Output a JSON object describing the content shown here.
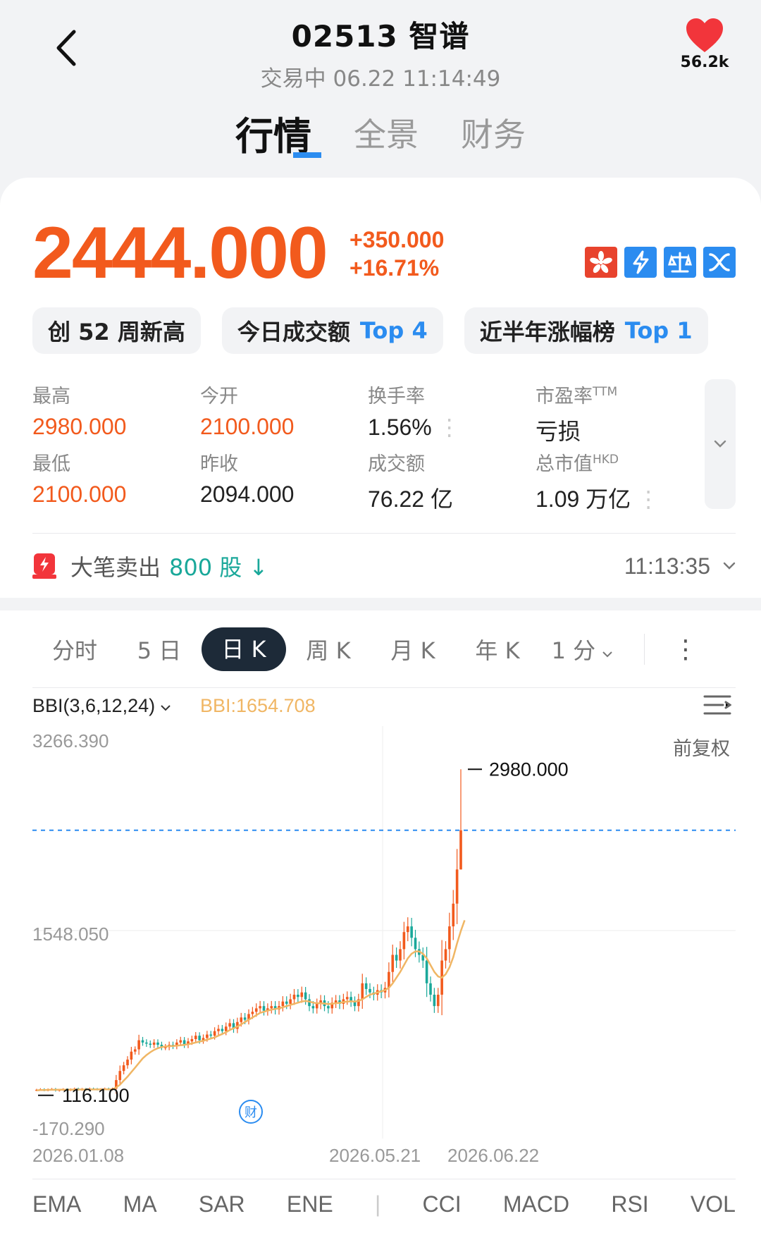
{
  "header": {
    "title": "02513 智谱",
    "status": "交易中 06.22 11:14:49",
    "favorites": "56.2k"
  },
  "tabs": [
    "行情",
    "全景",
    "财务"
  ],
  "quote": {
    "price": "2444.000",
    "change": "+350.000",
    "change_pct": "+16.71%"
  },
  "pills": [
    {
      "label": "创 52 周新高",
      "top": ""
    },
    {
      "label": "今日成交额",
      "top": "Top 4"
    },
    {
      "label": "近半年涨幅榜",
      "top": "Top 1"
    }
  ],
  "stats": {
    "high_label": "最高",
    "high": "2980.000",
    "open_label": "今开",
    "open": "2100.000",
    "turnover_label": "换手率",
    "turnover": "1.56%",
    "pe_label": "市盈率",
    "pe_sup": "TTM",
    "pe": "亏损",
    "low_label": "最低",
    "low": "2100.000",
    "prev_label": "昨收",
    "prev": "2094.000",
    "amount_label": "成交额",
    "amount": "76.22 亿",
    "mcap_label": "总市值",
    "mcap_sup": "HKD",
    "mcap": "1.09 万亿"
  },
  "trade": {
    "label": "大笔卖出",
    "qty": "800 股 ↓",
    "time": "11:13:35"
  },
  "ktabs": [
    "分时",
    "5 日",
    "日 K",
    "周 K",
    "月 K",
    "年 K",
    "1 分"
  ],
  "indicator": {
    "name": "BBI(3,6,12,24)",
    "value": "BBI:1654.708",
    "adjust": "前复权"
  },
  "chart_data": {
    "type": "candlestick",
    "y_labels": [
      "3266.390",
      "1548.050",
      "-170.290"
    ],
    "max_label": "2980.000",
    "min_label": "116.100",
    "x_labels": [
      "2026.01.08",
      "2026.05.21",
      "2026.06.22"
    ],
    "ylim": [
      -170.29,
      3266.39
    ],
    "dashed_price": 2444.0,
    "colors": {
      "up": "#f25a1d",
      "down": "#1aa89a",
      "bbi": "#f0b664",
      "dash": "#2b8cf0"
    },
    "closes": [
      165,
      170,
      160,
      168,
      172,
      158,
      165,
      170,
      162,
      168,
      175,
      165,
      172,
      168,
      175,
      172,
      168,
      170,
      175,
      168,
      175,
      250,
      330,
      380,
      430,
      500,
      520,
      600,
      580,
      570,
      560,
      580,
      560,
      540,
      540,
      560,
      550,
      580,
      600,
      560,
      590,
      610,
      640,
      600,
      620,
      650,
      640,
      680,
      700,
      680,
      720,
      750,
      700,
      760,
      800,
      780,
      830,
      850,
      880,
      900,
      860,
      880,
      900,
      870,
      900,
      940,
      920,
      960,
      1000,
      980,
      1020,
      960,
      900,
      880,
      920,
      950,
      900,
      880,
      930,
      950,
      920,
      960,
      980,
      940,
      900,
      960,
      1100,
      1050,
      1020,
      1000,
      1040,
      1020,
      1060,
      1200,
      1350,
      1300,
      1400,
      1550,
      1600,
      1500,
      1400,
      1350,
      1300,
      1100,
      1000,
      900,
      1000,
      1300,
      1400,
      1600,
      1800,
      2100,
      2444
    ],
    "bbi": [
      160,
      162,
      162,
      164,
      165,
      165,
      166,
      166,
      166,
      166,
      167,
      167,
      167,
      167,
      168,
      168,
      168,
      168,
      169,
      169,
      169,
      185,
      210,
      245,
      280,
      320,
      360,
      400,
      440,
      470,
      495,
      515,
      530,
      540,
      545,
      548,
      550,
      552,
      556,
      560,
      565,
      572,
      580,
      588,
      595,
      605,
      615,
      625,
      640,
      655,
      670,
      690,
      705,
      720,
      740,
      760,
      780,
      800,
      820,
      840,
      850,
      860,
      868,
      875,
      880,
      890,
      900,
      910,
      920,
      930,
      940,
      945,
      940,
      930,
      925,
      925,
      922,
      918,
      920,
      925,
      928,
      935,
      940,
      942,
      940,
      945,
      960,
      980,
      1000,
      1010,
      1020,
      1030,
      1040,
      1060,
      1100,
      1150,
      1200,
      1260,
      1320,
      1360,
      1380,
      1380,
      1360,
      1320,
      1260,
      1200,
      1160,
      1150,
      1180,
      1240,
      1330,
      1450,
      1560,
      1654
    ]
  },
  "indicator_tabs": [
    "EMA",
    "MA",
    "SAR",
    "ENE",
    "CCI",
    "MACD",
    "RSI",
    "VOL"
  ]
}
